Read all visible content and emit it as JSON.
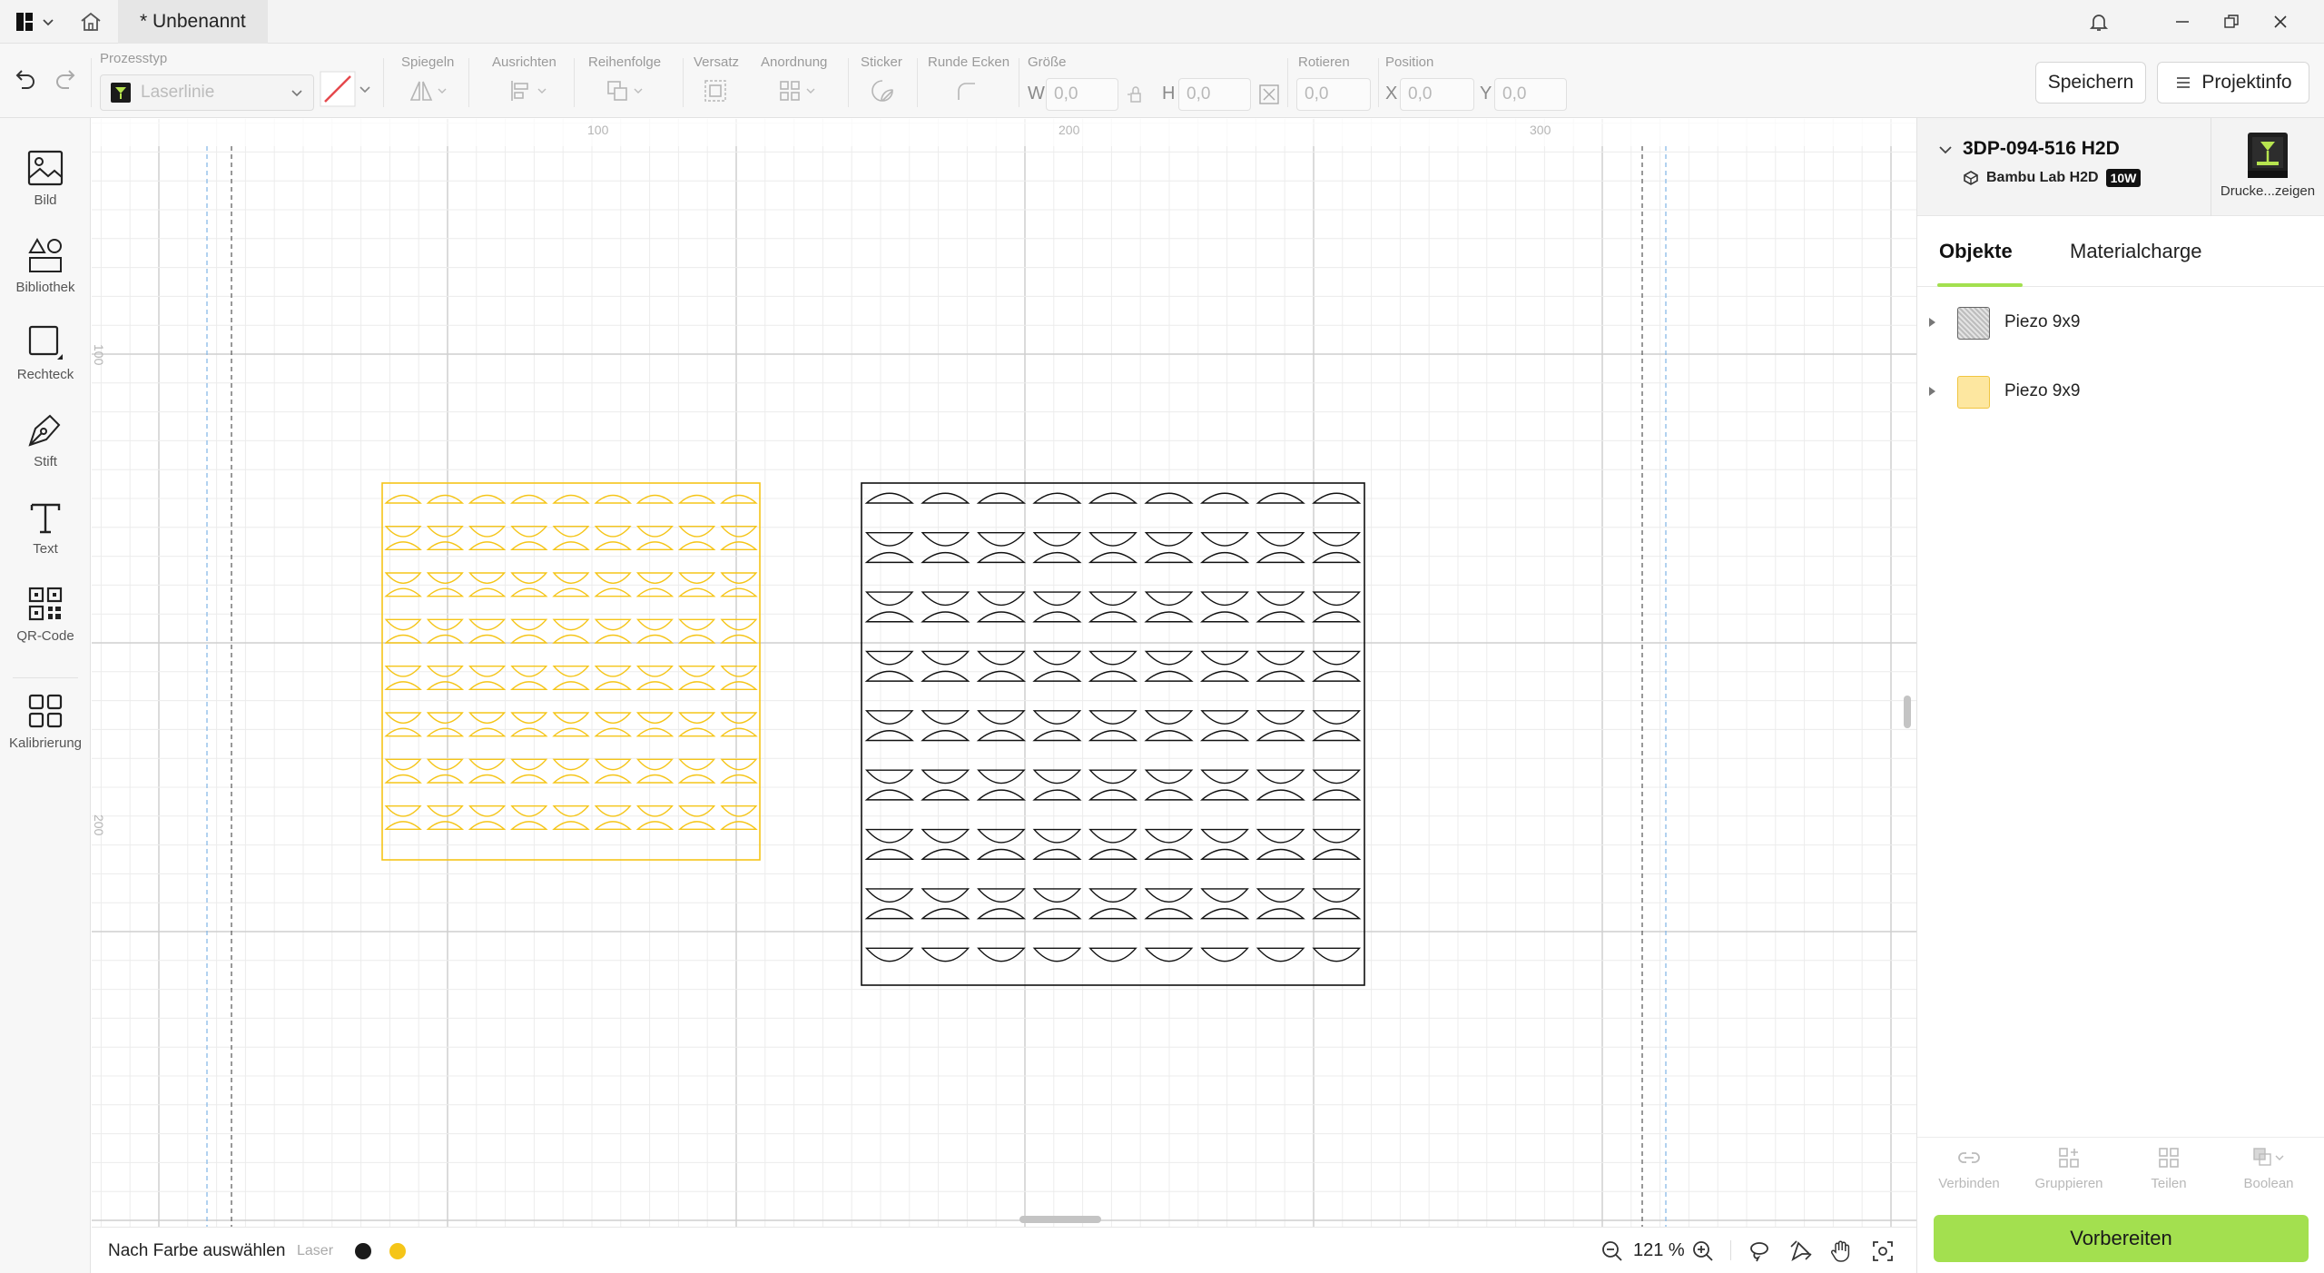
{
  "titlebar": {
    "tab_title": "* Unbenannt"
  },
  "toolbar": {
    "prozesstyp_label": "Prozesstyp",
    "prozesstyp_value": "Laserlinie",
    "spiegeln_label": "Spiegeln",
    "ausrichten_label": "Ausrichten",
    "reihenfolge_label": "Reihenfolge",
    "versatz_label": "Versatz",
    "anordnung_label": "Anordnung",
    "sticker_label": "Sticker",
    "runde_ecken_label": "Runde Ecken",
    "groesse_label": "Größe",
    "w_letter": "W",
    "w_value": "0,0",
    "h_letter": "H",
    "h_value": "0,0",
    "rotieren_label": "Rotieren",
    "rotieren_value": "0,0",
    "position_label": "Position",
    "x_letter": "X",
    "x_value": "0,0",
    "y_letter": "Y",
    "y_value": "0,0",
    "save_label": "Speichern",
    "projektinfo_label": "Projektinfo"
  },
  "leftbar": {
    "items": [
      {
        "label": "Bild"
      },
      {
        "label": "Bibliothek"
      },
      {
        "label": "Rechteck"
      },
      {
        "label": "Stift"
      },
      {
        "label": "Text"
      },
      {
        "label": "QR-Code"
      },
      {
        "label": "Kalibrierung"
      }
    ]
  },
  "canvas": {
    "ruler_top": [
      "100",
      "200",
      "300"
    ],
    "ruler_left": [
      "100",
      "200"
    ],
    "objects": [
      {
        "name": "Piezo 9x9",
        "color": "#f5c518",
        "rows": 15,
        "cols": 9
      },
      {
        "name": "Piezo 9x9",
        "color": "#111111",
        "rows": 16,
        "cols": 9
      }
    ]
  },
  "bottombar": {
    "select_by_color": "Nach Farbe auswählen",
    "laser_label": "Laser",
    "swatches": [
      "#1a1a1a",
      "#f5c518"
    ],
    "zoom": "121 %"
  },
  "device": {
    "name": "3DP-094-516 H2D",
    "model": "Bambu Lab H2D",
    "power_badge": "10W",
    "printer_link": "Drucke...zeigen"
  },
  "tabs": {
    "objects": "Objekte",
    "material": "Materialcharge"
  },
  "objects_list": [
    {
      "label": "Piezo 9x9",
      "kind": "gray"
    },
    {
      "label": "Piezo 9x9",
      "kind": "yellow"
    }
  ],
  "actions": {
    "verbinden": "Verbinden",
    "gruppieren": "Gruppieren",
    "teilen": "Teilen",
    "boolean": "Boolean"
  },
  "prepare_label": "Vorbereiten"
}
